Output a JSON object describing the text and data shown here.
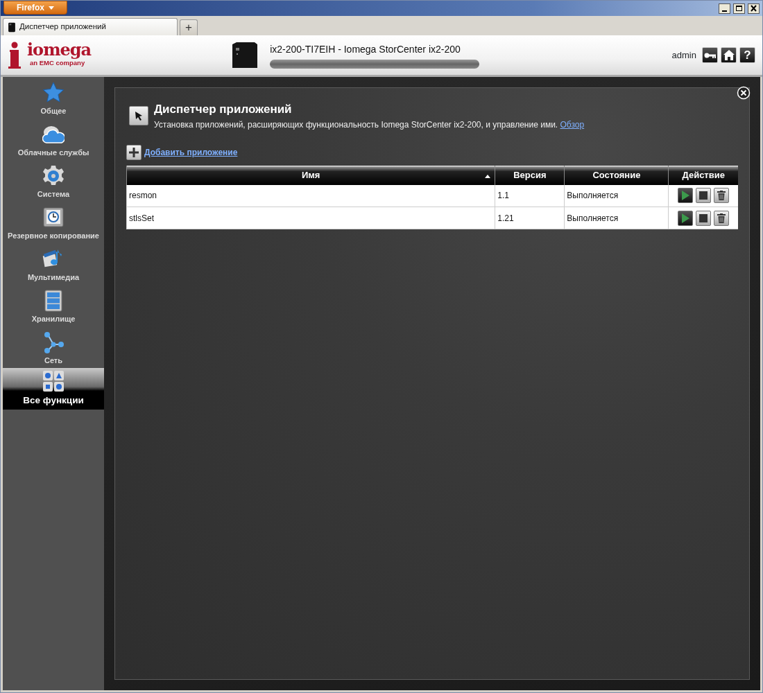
{
  "browser": {
    "menu_button": "Firefox",
    "tab": {
      "title": "Диспетчер приложений"
    },
    "new_tab": "+"
  },
  "header": {
    "brand": "iomega",
    "tagline": "an EMC company",
    "device": "ix2-200-TI7EIH - Iomega StorCenter ix2-200",
    "user": "admin",
    "help": "?"
  },
  "sidebar": {
    "items": [
      {
        "label": "Общее",
        "selected": false
      },
      {
        "label": "Облачные службы",
        "selected": false
      },
      {
        "label": "Система",
        "selected": false
      },
      {
        "label": "Резервное копирование",
        "selected": false
      },
      {
        "label": "Мультимедиа",
        "selected": false
      },
      {
        "label": "Хранилище",
        "selected": false
      },
      {
        "label": "Сеть",
        "selected": false
      },
      {
        "label": "Все функции",
        "selected": true
      }
    ]
  },
  "panel": {
    "title": "Диспетчер приложений",
    "description": "Установка приложений, расширяющих функциональность Iomega StorCenter ix2-200, и управление ими.",
    "description_link": "Обзор",
    "add_link": "Добавить приложение",
    "table": {
      "columns": [
        {
          "label": "Имя",
          "sorted": true
        },
        {
          "label": "Версия",
          "sorted": false
        },
        {
          "label": "Состояние",
          "sorted": false
        },
        {
          "label": "Действие",
          "sorted": false
        }
      ],
      "rows": [
        {
          "name": "resmon",
          "version": "1.1",
          "status": "Выполняется"
        },
        {
          "name": "stlsSet",
          "version": "1.21",
          "status": "Выполняется"
        }
      ]
    }
  }
}
